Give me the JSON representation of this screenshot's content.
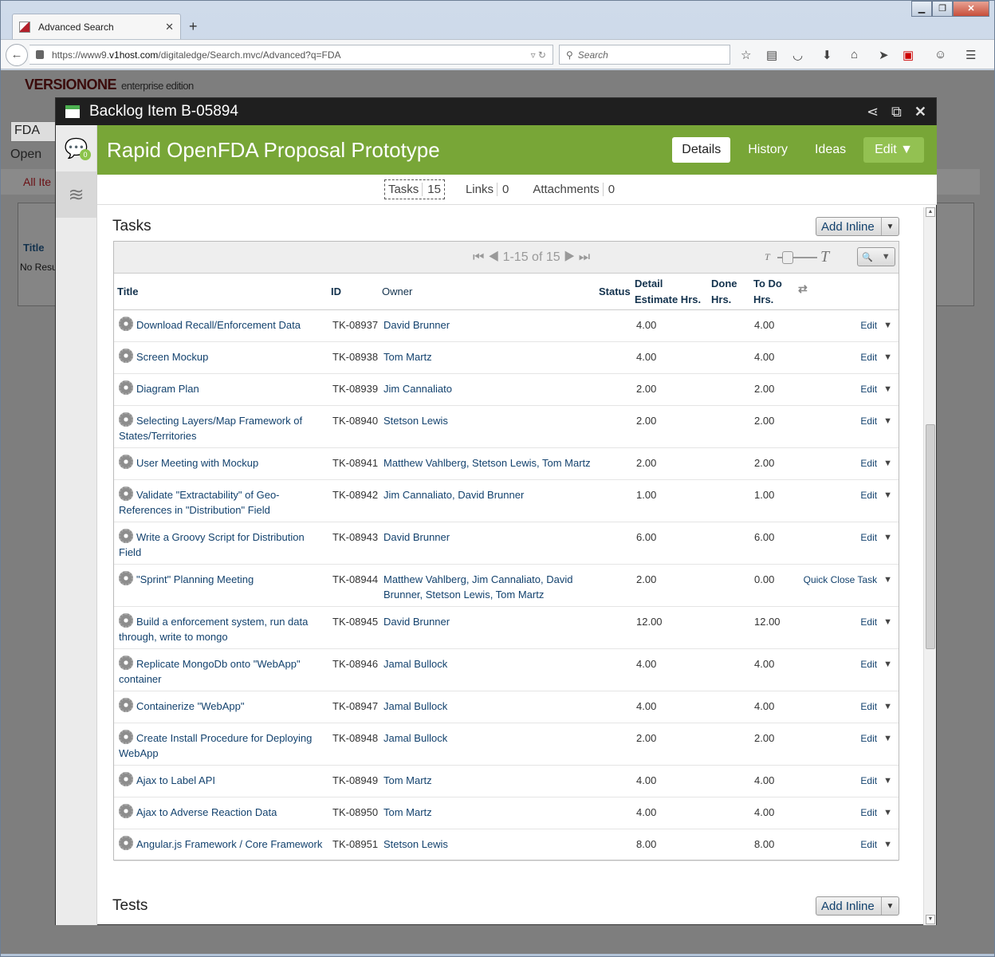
{
  "browser": {
    "tab_title": "Advanced Search",
    "url_prefix": "https://www9.",
    "url_host": "v1host.com",
    "url_path": "/digitaledge/Search.mvc/Advanced?q=FDA",
    "search_placeholder": "Search"
  },
  "bg": {
    "logo": "VERSIONONE",
    "edition": "enterprise edition",
    "query": "FDA",
    "open_label": "Open",
    "all_items": "All Ite",
    "title_col": "Title",
    "no_results": "No Resu"
  },
  "modal": {
    "header": "Backlog Item B-05894",
    "title": "Rapid OpenFDA Proposal Prototype",
    "comment_count": "0",
    "tabs": {
      "details": "Details",
      "history": "History",
      "ideas": "Ideas",
      "edit": "Edit"
    },
    "subtabs": {
      "tasks": "Tasks",
      "tasks_count": "15",
      "links": "Links",
      "links_count": "0",
      "attachments": "Attachments",
      "attachments_count": "0"
    }
  },
  "tasks_section": {
    "title": "Tasks",
    "add_inline": "Add Inline",
    "pager": "1-15 of 15",
    "columns": {
      "title": "Title",
      "id": "ID",
      "owner": "Owner",
      "status": "Status",
      "detail_estimate": "Detail Estimate Hrs.",
      "done": "Done Hrs.",
      "todo": "To Do Hrs."
    },
    "rows": [
      {
        "title": "Download Recall/Enforcement Data",
        "id": "TK-08937",
        "owner": "David Brunner",
        "estimate": "4.00",
        "todo": "4.00",
        "action": "Edit"
      },
      {
        "title": "Screen Mockup",
        "id": "TK-08938",
        "owner": "Tom Martz",
        "estimate": "4.00",
        "todo": "4.00",
        "action": "Edit"
      },
      {
        "title": "Diagram Plan",
        "id": "TK-08939",
        "owner": "Jim Cannaliato",
        "estimate": "2.00",
        "todo": "2.00",
        "action": "Edit"
      },
      {
        "title": "Selecting Layers/Map Framework of States/Territories",
        "id": "TK-08940",
        "owner": "Stetson Lewis",
        "estimate": "2.00",
        "todo": "2.00",
        "action": "Edit"
      },
      {
        "title": "User Meeting with Mockup",
        "id": "TK-08941",
        "owner": "Matthew Vahlberg, Stetson Lewis, Tom Martz",
        "estimate": "2.00",
        "todo": "2.00",
        "action": "Edit"
      },
      {
        "title": "Validate \"Extractability\" of Geo-References in \"Distribution\" Field",
        "id": "TK-08942",
        "owner": "Jim Cannaliato, David Brunner",
        "estimate": "1.00",
        "todo": "1.00",
        "action": "Edit"
      },
      {
        "title": "Write a Groovy Script for Distribution Field",
        "id": "TK-08943",
        "owner": "David Brunner",
        "estimate": "6.00",
        "todo": "6.00",
        "action": "Edit"
      },
      {
        "title": "\"Sprint\" Planning Meeting",
        "id": "TK-08944",
        "owner": "Matthew Vahlberg, Jim Cannaliato, David Brunner, Stetson Lewis, Tom Martz",
        "estimate": "2.00",
        "todo": "0.00",
        "action": "Quick Close Task"
      },
      {
        "title": "Build a enforcement system, run data through, write to mongo",
        "id": "TK-08945",
        "owner": "David Brunner",
        "estimate": "12.00",
        "todo": "12.00",
        "action": "Edit"
      },
      {
        "title": "Replicate MongoDb onto \"WebApp\" container",
        "id": "TK-08946",
        "owner": "Jamal Bullock",
        "estimate": "4.00",
        "todo": "4.00",
        "action": "Edit"
      },
      {
        "title": "Containerize \"WebApp\"",
        "id": "TK-08947",
        "owner": "Jamal Bullock",
        "estimate": "4.00",
        "todo": "4.00",
        "action": "Edit"
      },
      {
        "title": "Create Install Procedure for Deploying WebApp",
        "id": "TK-08948",
        "owner": "Jamal Bullock",
        "estimate": "2.00",
        "todo": "2.00",
        "action": "Edit"
      },
      {
        "title": "Ajax to Label API",
        "id": "TK-08949",
        "owner": "Tom Martz",
        "estimate": "4.00",
        "todo": "4.00",
        "action": "Edit"
      },
      {
        "title": "Ajax to Adverse Reaction Data",
        "id": "TK-08950",
        "owner": "Tom Martz",
        "estimate": "4.00",
        "todo": "4.00",
        "action": "Edit"
      },
      {
        "title": "Angular.js Framework / Core Framework",
        "id": "TK-08951",
        "owner": "Stetson Lewis",
        "estimate": "8.00",
        "todo": "8.00",
        "action": "Edit"
      }
    ]
  },
  "tests_section": {
    "title": "Tests",
    "add_inline": "Add Inline"
  }
}
